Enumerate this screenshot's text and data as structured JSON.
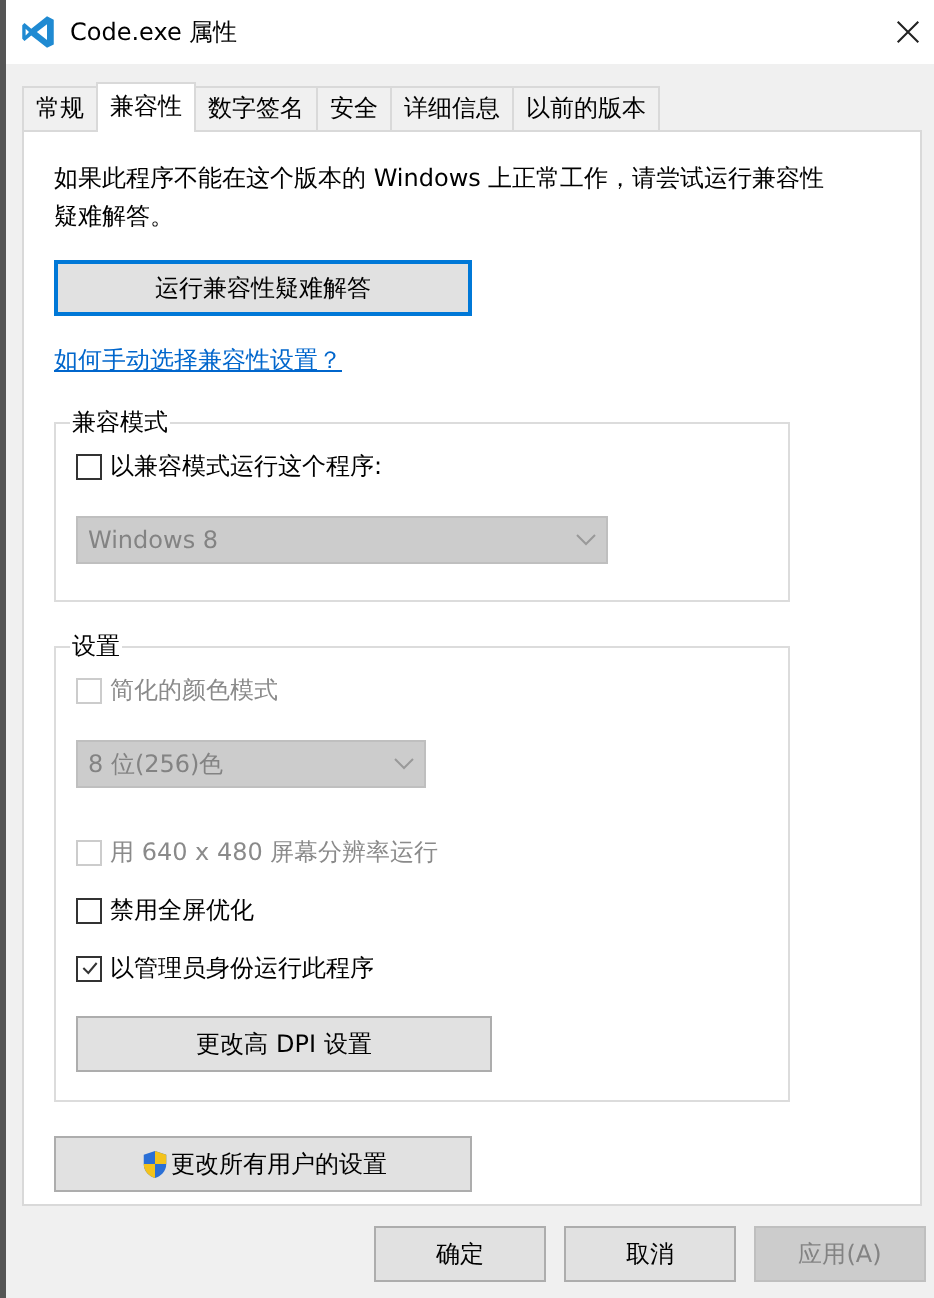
{
  "window": {
    "title": "Code.exe 属性"
  },
  "tabs": [
    {
      "label": "常规",
      "selected": false
    },
    {
      "label": "兼容性",
      "selected": true
    },
    {
      "label": "数字签名",
      "selected": false
    },
    {
      "label": "安全",
      "selected": false
    },
    {
      "label": "详细信息",
      "selected": false
    },
    {
      "label": "以前的版本",
      "selected": false
    }
  ],
  "intro": "如果此程序不能在这个版本的 Windows 上正常工作，请尝试运行兼容性疑难解答。",
  "troubleshoot_button": {
    "label": "运行兼容性疑难解答",
    "focused": true
  },
  "help_link": "如何手动选择兼容性设置？",
  "groups": [
    {
      "title": "兼容模式",
      "items": [
        {
          "kind": "checkbox",
          "label": "以兼容模式运行这个程序:",
          "checked": false,
          "disabled": false
        },
        {
          "kind": "dropdown",
          "value": "Windows 8",
          "disabled": true
        }
      ]
    },
    {
      "title": "设置",
      "items": [
        {
          "kind": "checkbox",
          "label": "简化的颜色模式",
          "checked": false,
          "disabled": true
        },
        {
          "kind": "dropdown",
          "value": "8 位(256)色",
          "disabled": true
        },
        {
          "kind": "checkbox",
          "label": "用 640 x 480 屏幕分辨率运行",
          "checked": false,
          "disabled": true
        },
        {
          "kind": "checkbox",
          "label": "禁用全屏优化",
          "checked": false,
          "disabled": false
        },
        {
          "kind": "checkbox",
          "label": "以管理员身份运行此程序",
          "checked": true,
          "disabled": false
        },
        {
          "kind": "button",
          "label": "更改高 DPI 设置"
        }
      ]
    }
  ],
  "all_users_button": {
    "label": "更改所有用户的设置"
  },
  "dialog_buttons": [
    {
      "label": "确定",
      "disabled": false
    },
    {
      "label": "取消",
      "disabled": false
    },
    {
      "label": "应用(A)",
      "disabled": true
    }
  ]
}
